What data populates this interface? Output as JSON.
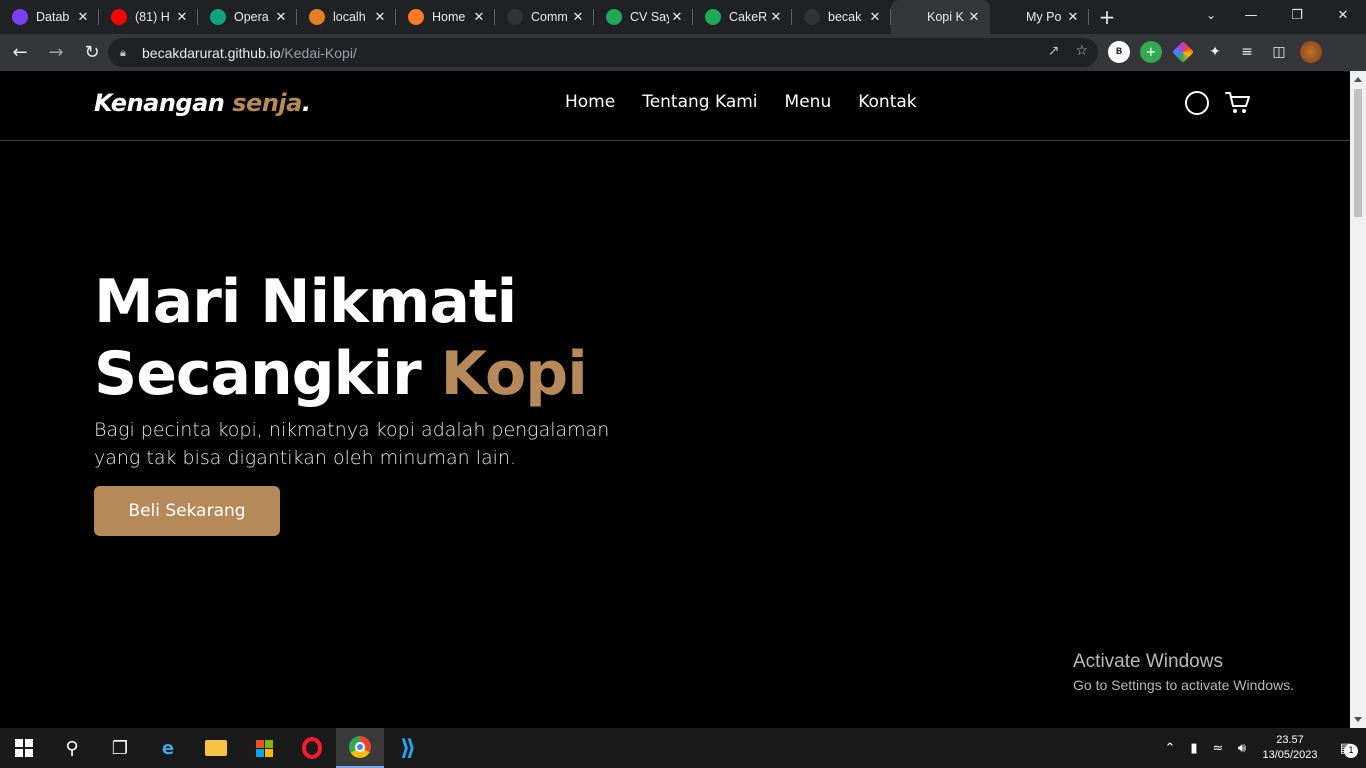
{
  "browser": {
    "tabs": [
      {
        "title": "Datab",
        "favicon": "u-icon",
        "color": "#7b3ff2"
      },
      {
        "title": "(81) H",
        "favicon": "youtube-icon",
        "color": "#ff0000"
      },
      {
        "title": "Opera",
        "favicon": "openai-icon",
        "color": "#10a37f"
      },
      {
        "title": "localh",
        "favicon": "xampp-icon",
        "color": "#e67e22"
      },
      {
        "title": "Home",
        "favicon": "xampp-icon",
        "color": "#fb7a24"
      },
      {
        "title": "Comm",
        "favicon": "github-icon",
        "color": "#333333"
      },
      {
        "title": "CV Say",
        "favicon": "c-icon",
        "color": "#1faa59"
      },
      {
        "title": "CakeR",
        "favicon": "c-icon",
        "color": "#1faa59"
      },
      {
        "title": "becak",
        "favicon": "github-icon",
        "color": "#333333"
      },
      {
        "title": "Kopi K",
        "favicon": "globe-icon",
        "color": "#35363a",
        "active": true
      },
      {
        "title": "My Po",
        "favicon": "globe-icon",
        "color": "#202124"
      }
    ],
    "url_host": "becakdarurat.github.io",
    "url_path": "/Kedai-Kopi/",
    "profile_letter": "B"
  },
  "site": {
    "logo_main": "Kenangan ",
    "logo_accent": "senja",
    "logo_dot": ".",
    "nav": [
      "Home",
      "Tentang Kami",
      "Menu",
      "Kontak"
    ],
    "hero_line1": "Mari Nikmati",
    "hero_line2_main": "Secangkir ",
    "hero_line2_accent": "Kopi",
    "hero_text": "Bagi pecinta kopi, nikmatnya kopi adalah pengalaman yang tak bisa digantikan oleh minuman lain.",
    "cta": "Beli Sekarang",
    "accent_color": "#b6895b"
  },
  "watermark": {
    "line1": "Activate Windows",
    "line2": "Go to Settings to activate Windows."
  },
  "taskbar": {
    "time": "23.57",
    "date": "13/05/2023",
    "notifications": "1"
  }
}
